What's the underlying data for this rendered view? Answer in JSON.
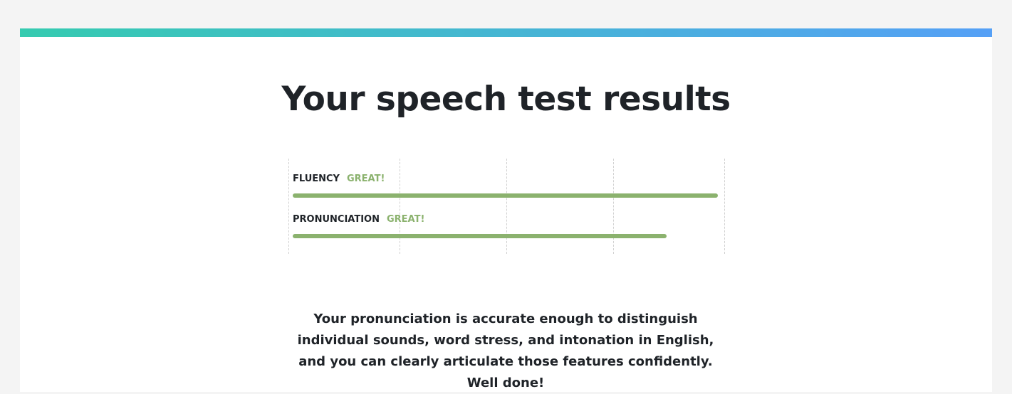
{
  "header": {
    "title": "Your speech test results",
    "accent_gradient": [
      "#35cbb0",
      "#55a0f6"
    ]
  },
  "metrics": [
    {
      "label": "FLUENCY",
      "grade": "GREAT!",
      "level_fraction": 1.0,
      "color": "#8bb26e"
    },
    {
      "label": "PRONUNCIATION",
      "grade": "GREAT!",
      "level_fraction": 0.88,
      "color": "#8bb26e"
    }
  ],
  "description": "Your pronunciation is accurate enough to distinguish individual sounds, word stress, and intonation in English, and you can clearly articulate those features confidently. Well done!"
}
